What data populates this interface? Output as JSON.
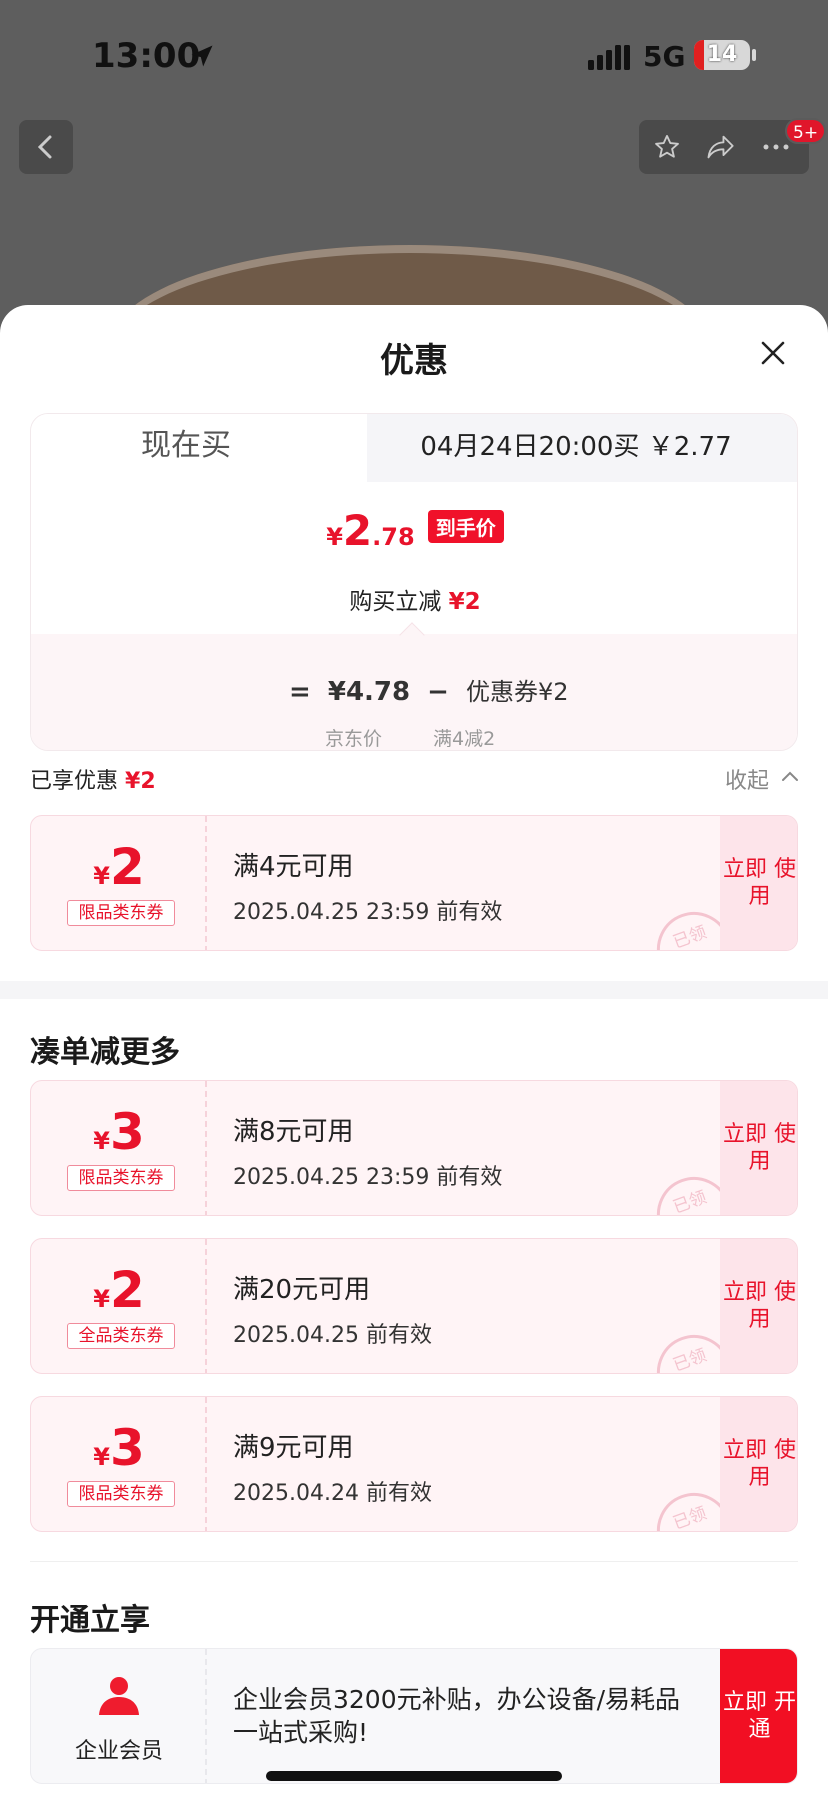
{
  "status_bar": {
    "time": "13:00",
    "network": "5G",
    "battery": "14"
  },
  "nav": {
    "badge": "5+"
  },
  "sheet": {
    "title": "优惠",
    "tabs": {
      "now": "现在买",
      "later": "04月24日20:00买 ￥2.77"
    },
    "price": {
      "yen": "¥",
      "int": "2",
      "dec": ".78",
      "tag": "到手价"
    },
    "reduce": {
      "label": "购买立减",
      "amount": "¥2"
    },
    "formula": {
      "eq": "=",
      "jd_price": "¥4.78",
      "minus": "−",
      "coupon": "优惠券¥2",
      "jd_label": "京东价",
      "coupon_rule": "满4减2"
    },
    "enjoyed": {
      "label": "已享优惠",
      "amount": "¥2"
    },
    "collapse": "收起"
  },
  "applied_coupons": [
    {
      "yen": "¥",
      "amount": "2",
      "scope": "限品类东券",
      "condition": "满4元可用",
      "expiry": "2025.04.25 23:59 前有效",
      "action": "立即 使用",
      "stamp": "已领"
    }
  ],
  "more_section": {
    "title": "凑单减更多"
  },
  "more_coupons": [
    {
      "yen": "¥",
      "amount": "3",
      "scope": "限品类东券",
      "condition": "满8元可用",
      "expiry": "2025.04.25 23:59 前有效",
      "action": "立即 使用",
      "stamp": "已领"
    },
    {
      "yen": "¥",
      "amount": "2",
      "scope": "全品类东券",
      "condition": "满20元可用",
      "expiry": "2025.04.25 前有效",
      "action": "立即 使用",
      "stamp": "已领"
    },
    {
      "yen": "¥",
      "amount": "3",
      "scope": "限品类东券",
      "condition": "满9元可用",
      "expiry": "2025.04.24 前有效",
      "action": "立即 使用",
      "stamp": "已领"
    }
  ],
  "open_section": {
    "title": "开通立享",
    "member_label": "企业会员",
    "description": "企业会员3200元补贴，办公设备/易耗品一站式采购!",
    "action": "立即 开通"
  },
  "colors": {
    "accent": "#e8132b",
    "coupon_bg": "#fff4f6"
  }
}
